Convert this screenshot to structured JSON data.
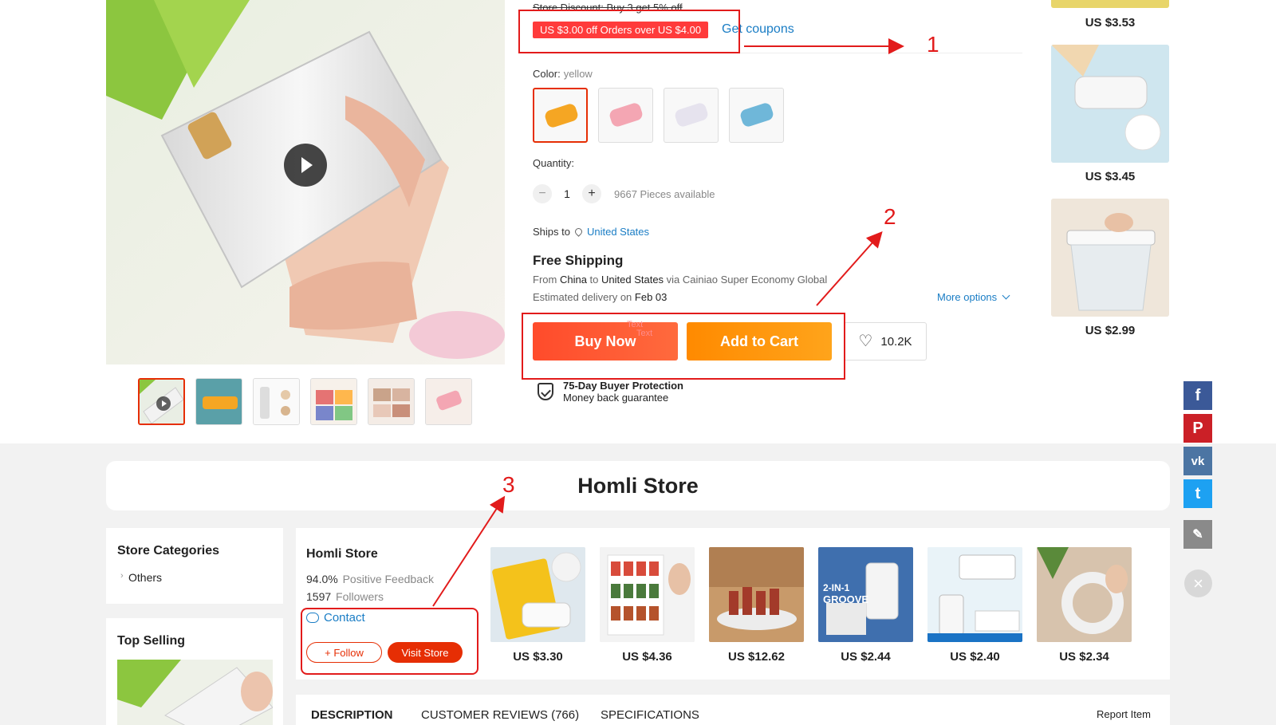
{
  "product": {
    "store_discount": "Store Discount: Buy 3 get 5% off",
    "coupon_chip": "US $3.00 off Orders over US $4.00",
    "get_coupons": "Get coupons",
    "color_label": "Color:",
    "color_value": "yellow",
    "color_swatches": [
      {
        "name": "yellow",
        "color": "#f5a623"
      },
      {
        "name": "pink",
        "color": "#f4a6b3"
      },
      {
        "name": "white",
        "color": "#e6e3ee"
      },
      {
        "name": "blue",
        "color": "#6fb7d9"
      }
    ],
    "quantity_label": "Quantity:",
    "quantity_minus": "−",
    "quantity_value": "1",
    "quantity_plus": "+",
    "pieces_available": "9667 Pieces available",
    "ships_to_label": "Ships to",
    "ships_to_country": "United States",
    "free_shipping": "Free Shipping",
    "from_prefix": "From ",
    "from_origin": "China",
    "from_to": " to ",
    "from_dest": "United States",
    "from_via": " via Cainiao Super Economy Global",
    "eta_prefix": "Estimated delivery on ",
    "eta_date": "Feb 03",
    "more_options": "More options",
    "buy_now": "Buy Now",
    "add_to_cart": "Add to Cart",
    "wishlist_count": "10.2K",
    "overlay_text_1": "Text",
    "overlay_text_2": "Text",
    "protection_title": "75-Day Buyer Protection",
    "protection_sub": "Money back guarantee"
  },
  "recommendations": [
    {
      "price": "US $3.53"
    },
    {
      "price": "US $3.45"
    },
    {
      "price": "US $2.99"
    }
  ],
  "store": {
    "banner_title": "Homli Store",
    "categories_heading": "Store Categories",
    "categories": [
      "Others"
    ],
    "top_selling_heading": "Top Selling",
    "name": "Homli Store",
    "feedback_value": "94.0%",
    "feedback_label": "Positive Feedback",
    "followers_value": "1597",
    "followers_label": "Followers",
    "contact": "Contact",
    "follow": "+ Follow",
    "visit_store": "Visit Store",
    "products": [
      {
        "price": "US $3.30"
      },
      {
        "price": "US $4.36"
      },
      {
        "price": "US $12.62"
      },
      {
        "price": "US $2.44"
      },
      {
        "price": "US $2.40"
      },
      {
        "price": "US $2.34"
      }
    ],
    "product_image_texts": {
      "groove_title": "2-IN-1",
      "groove_sub": "GROOVE"
    }
  },
  "tabs": {
    "description": "DESCRIPTION",
    "reviews": "CUSTOMER REVIEWS (766)",
    "specifications": "SPECIFICATIONS",
    "report_item": "Report Item"
  },
  "social": [
    {
      "name": "facebook",
      "glyph": "f",
      "color": "#3b5998"
    },
    {
      "name": "pinterest",
      "glyph": "P",
      "color": "#cb2027"
    },
    {
      "name": "vk",
      "glyph": "vk",
      "color": "#4c75a3"
    },
    {
      "name": "twitter",
      "glyph": "t",
      "color": "#1da1f2"
    },
    {
      "name": "edit",
      "glyph": "✎",
      "color": "#8a8a8a"
    }
  ],
  "annotations": {
    "n1": "1",
    "n2": "2",
    "n3": "3",
    "color": "#e21b1b"
  }
}
